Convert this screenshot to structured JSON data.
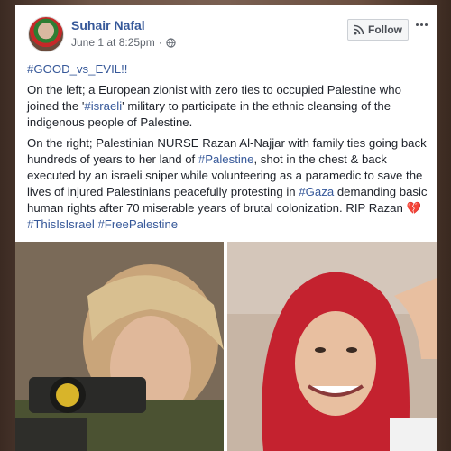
{
  "post": {
    "author": "Suhair Nafal",
    "date": "June 1 at 8:25pm",
    "separator": "·",
    "follow_label": "Follow",
    "paragraphs": {
      "p1": "#GOOD_vs_EVIL!!",
      "p2_a": "On the left; a European zionist with zero ties to occupied Palestine who joined the '",
      "p2_tag": "#israeli",
      "p2_b": "' military to participate in the ethnic cleansing of the indigenous people of Palestine.",
      "p3_a": "On the right; Palestinian NURSE Razan Al-Najjar with family ties going back hundreds of years to her land of ",
      "p3_tag1": "#Palestine",
      "p3_b": ", shot in the chest & back executed by an israeli sniper while volunteering as a paramedic to save the lives of injured Palestinians peacefully protesting in ",
      "p3_tag2": "#Gaza",
      "p3_c": " demanding basic human rights after 70 miserable years of brutal colonization. RIP Razan ",
      "p3_heart": "💔",
      "p3_tag3": "#ThisIsIsrael",
      "p3_tag4": "#FreePalestine"
    }
  },
  "colors": {
    "link": "#365899",
    "text": "#1d2129",
    "meta": "#616770"
  },
  "icons": [
    "avatar",
    "globe-icon",
    "rss-icon",
    "more-icon",
    "broken-heart-icon"
  ]
}
